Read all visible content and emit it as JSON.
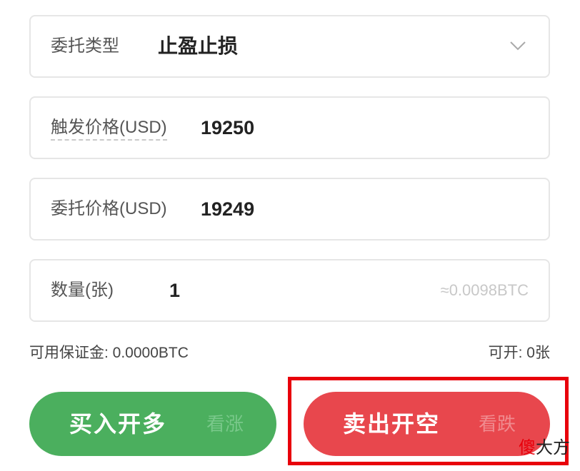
{
  "order_type": {
    "label": "委托类型",
    "value": "止盈止损",
    "icon": "chevron-down-icon"
  },
  "trigger_price": {
    "label": "触发价格(USD)",
    "value": "19250"
  },
  "order_price": {
    "label": "委托价格(USD)",
    "value": "19249"
  },
  "quantity": {
    "label": "数量(张)",
    "value": "1",
    "hint": "≈0.0098BTC"
  },
  "info": {
    "available_margin": "可用保证金: 0.0000BTC",
    "can_open": "可开: 0张"
  },
  "buttons": {
    "buy_label": "买入开多",
    "buy_sub": "看涨",
    "sell_label": "卖出开空",
    "sell_sub": "看跌"
  },
  "watermark": {
    "accent": "傻",
    "rest": "大方"
  },
  "colors": {
    "buy": "#4baf5e",
    "sell": "#e8474d",
    "highlight": "#e8000b",
    "border": "#e6e6e6"
  }
}
